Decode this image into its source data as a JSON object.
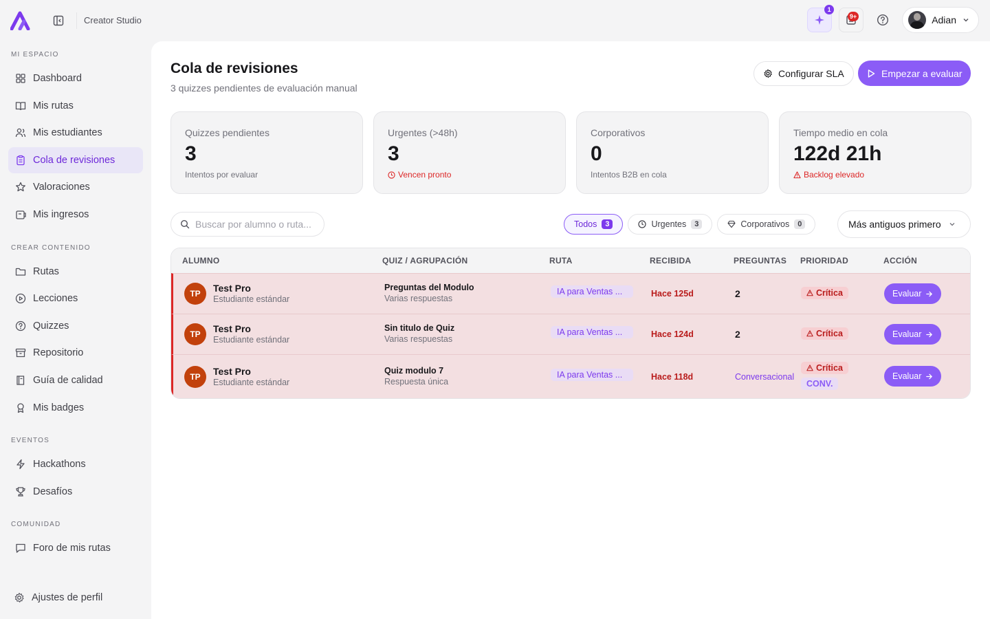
{
  "app": {
    "studio_label": "Creator Studio"
  },
  "colors": {
    "accent": "#8b5cf6",
    "danger": "#dc2626"
  },
  "topbar": {
    "ai_badge": "1",
    "notif_badge": "9+",
    "user_name": "Adian"
  },
  "sidebar": {
    "sections": [
      {
        "title": "MI ESPACIO",
        "items": [
          {
            "label": "Dashboard",
            "icon": "grid-icon"
          },
          {
            "label": "Mis rutas",
            "icon": "book-icon"
          },
          {
            "label": "Mis estudiantes",
            "icon": "users-icon"
          },
          {
            "label": "Cola de revisiones",
            "icon": "clipboard-icon",
            "active": true
          },
          {
            "label": "Valoraciones",
            "icon": "star-icon"
          },
          {
            "label": "Mis ingresos",
            "icon": "wallet-icon"
          }
        ]
      },
      {
        "title": "CREAR CONTENIDO",
        "items": [
          {
            "label": "Rutas",
            "icon": "folder-icon"
          },
          {
            "label": "Lecciones",
            "icon": "play-circle-icon"
          },
          {
            "label": "Quizzes",
            "icon": "help-circle-icon"
          },
          {
            "label": "Repositorio",
            "icon": "archive-icon"
          },
          {
            "label": "Guía de calidad",
            "icon": "book-guide-icon"
          },
          {
            "label": "Mis badges",
            "icon": "award-icon"
          }
        ]
      },
      {
        "title": "EVENTOS",
        "items": [
          {
            "label": "Hackathons",
            "icon": "zap-icon"
          },
          {
            "label": "Desafíos",
            "icon": "trophy-icon"
          }
        ]
      },
      {
        "title": "COMUNIDAD",
        "items": [
          {
            "label": "Foro de mis rutas",
            "icon": "message-icon"
          }
        ]
      }
    ],
    "footer": {
      "label": "Ajustes de perfil",
      "icon": "gear-icon"
    }
  },
  "page": {
    "title": "Cola de revisiones",
    "subtitle": "3 quizzes pendientes de evaluación manual",
    "sla_button": "Configurar SLA",
    "start_button": "Empezar a evaluar"
  },
  "cards": [
    {
      "label": "Quizzes pendientes",
      "value": "3",
      "note": "Intentos por evaluar",
      "tone": "muted"
    },
    {
      "label": "Urgentes (>48h)",
      "value": "3",
      "note": "Vencen pronto",
      "tone": "red"
    },
    {
      "label": "Corporativos",
      "value": "0",
      "note": "Intentos B2B en cola",
      "tone": "muted"
    },
    {
      "label": "Tiempo medio en cola",
      "value": "122d 21h",
      "note": "Backlog elevado",
      "tone": "red"
    }
  ],
  "search": {
    "placeholder": "Buscar por alumno o ruta..."
  },
  "filters": [
    {
      "label": "Todos",
      "count": "3",
      "active": true
    },
    {
      "label": "Urgentes",
      "count": "3",
      "icon": "clock-icon"
    },
    {
      "label": "Corporativos",
      "count": "0",
      "icon": "gem-icon"
    }
  ],
  "sort": {
    "label": "Más antiguos primero"
  },
  "table": {
    "headers": [
      "ALUMNO",
      "QUIZ / AGRUPACIÓN",
      "RUTA",
      "RECIBIDA",
      "PREGUNTAS",
      "PRIORIDAD",
      "ACCIÓN"
    ],
    "rows": [
      {
        "initials": "TP",
        "name": "Test Pro",
        "role": "Estudiante estándar",
        "quiz": "Preguntas del Modulo",
        "quiz_type": "Varias respuestas",
        "route": "IA para Ventas ...",
        "received": "Hace 125d",
        "questions": "2",
        "priority": "Crítica",
        "action": "Evaluar"
      },
      {
        "initials": "TP",
        "name": "Test Pro",
        "role": "Estudiante estándar",
        "quiz": "Sin titulo de Quiz",
        "quiz_type": "Varias respuestas",
        "route": "IA para Ventas ...",
        "received": "Hace 124d",
        "questions": "2",
        "priority": "Crítica",
        "action": "Evaluar"
      },
      {
        "initials": "TP",
        "name": "Test Pro",
        "role": "Estudiante estándar",
        "quiz": "Quiz modulo 7",
        "quiz_type": "Respuesta única",
        "route": "IA para Ventas ...",
        "received": "Hace 118d",
        "questions": "Conversacional",
        "priority": "Crítica",
        "tag": "CONV.",
        "action": "Evaluar"
      }
    ]
  }
}
